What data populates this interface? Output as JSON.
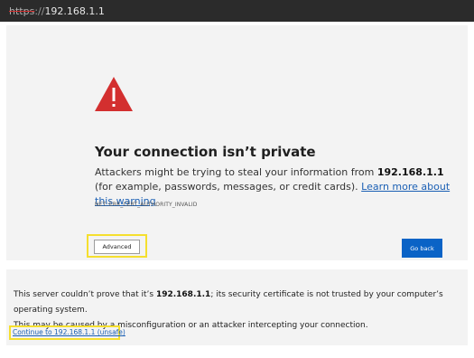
{
  "address_bar": {
    "protocol": "https",
    "separator": "://",
    "host": "192.168.1.1"
  },
  "warning": {
    "icon": "warning-triangle-icon",
    "icon_color": "#d32f2f",
    "title": "Your connection isn’t private",
    "desc_prefix": "Attackers might be trying to steal your information from ",
    "desc_host": "192.168.1.1",
    "desc_suffix": " (for example, passwords, messages, or credit cards). ",
    "learn_more": "Learn more about this warning",
    "error_code": "NET::ERR_CERT_AUTHORITY_INVALID"
  },
  "buttons": {
    "advanced": "Advanced",
    "go_back": "Go back",
    "go_back_color": "#0a63c6"
  },
  "details": {
    "line1_prefix": "This server couldn’t prove that it’s ",
    "line1_host": "192.168.1.1",
    "line1_suffix": "; its security certificate is not trusted by your computer’s operating system.",
    "line2": "This may be caused by a misconfiguration or an attacker intercepting your connection.",
    "continue_link": "Continue to 192.168.1.1 (unsafe)"
  },
  "highlight_color": "#f5df2e"
}
